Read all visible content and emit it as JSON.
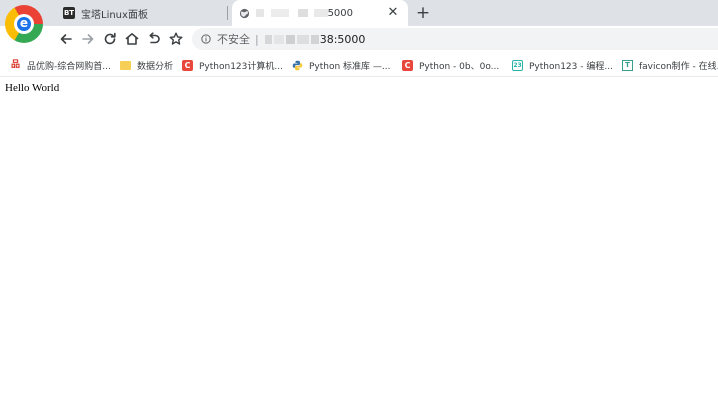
{
  "tabs": [
    {
      "title": "宝塔Linux面板",
      "favicon": "BT",
      "active": false
    },
    {
      "title_suffix": "5000",
      "favicon": "globe-icon",
      "active": true,
      "close": "✕"
    }
  ],
  "new_tab": "+",
  "toolbar": {
    "back": "arrow-left-icon",
    "forward": "arrow-right-icon",
    "reload": "reload-icon",
    "home": "home-icon",
    "undo": "undo-icon",
    "bookmark_star": "star-icon"
  },
  "address_bar": {
    "security_label": "不安全",
    "separator": "|",
    "url_visible": "38:5000"
  },
  "bookmarks": [
    {
      "label": "品优购-综合网购首...",
      "icon": "red-logo-icon",
      "glyph": "品"
    },
    {
      "label": "数据分析",
      "icon": "folder-icon",
      "glyph": ""
    },
    {
      "label": "Python123计算机...",
      "icon": "red-c-icon",
      "glyph": "C"
    },
    {
      "label": "Python 标准库 —...",
      "icon": "python-icon",
      "glyph": ""
    },
    {
      "label": "Python - 0b、0o...",
      "icon": "red-c-icon",
      "glyph": "C"
    },
    {
      "label": "Python123 - 编程...",
      "icon": "teal-board-icon",
      "glyph": "23"
    },
    {
      "label": "favicon制作 - 在线...",
      "icon": "favicon-tool-icon",
      "glyph": "T"
    }
  ],
  "page": {
    "text": "Hello World"
  },
  "colors": {
    "tabstrip": "#dee1e6",
    "omnibox": "#f1f3f4",
    "text": "#3c4043"
  }
}
